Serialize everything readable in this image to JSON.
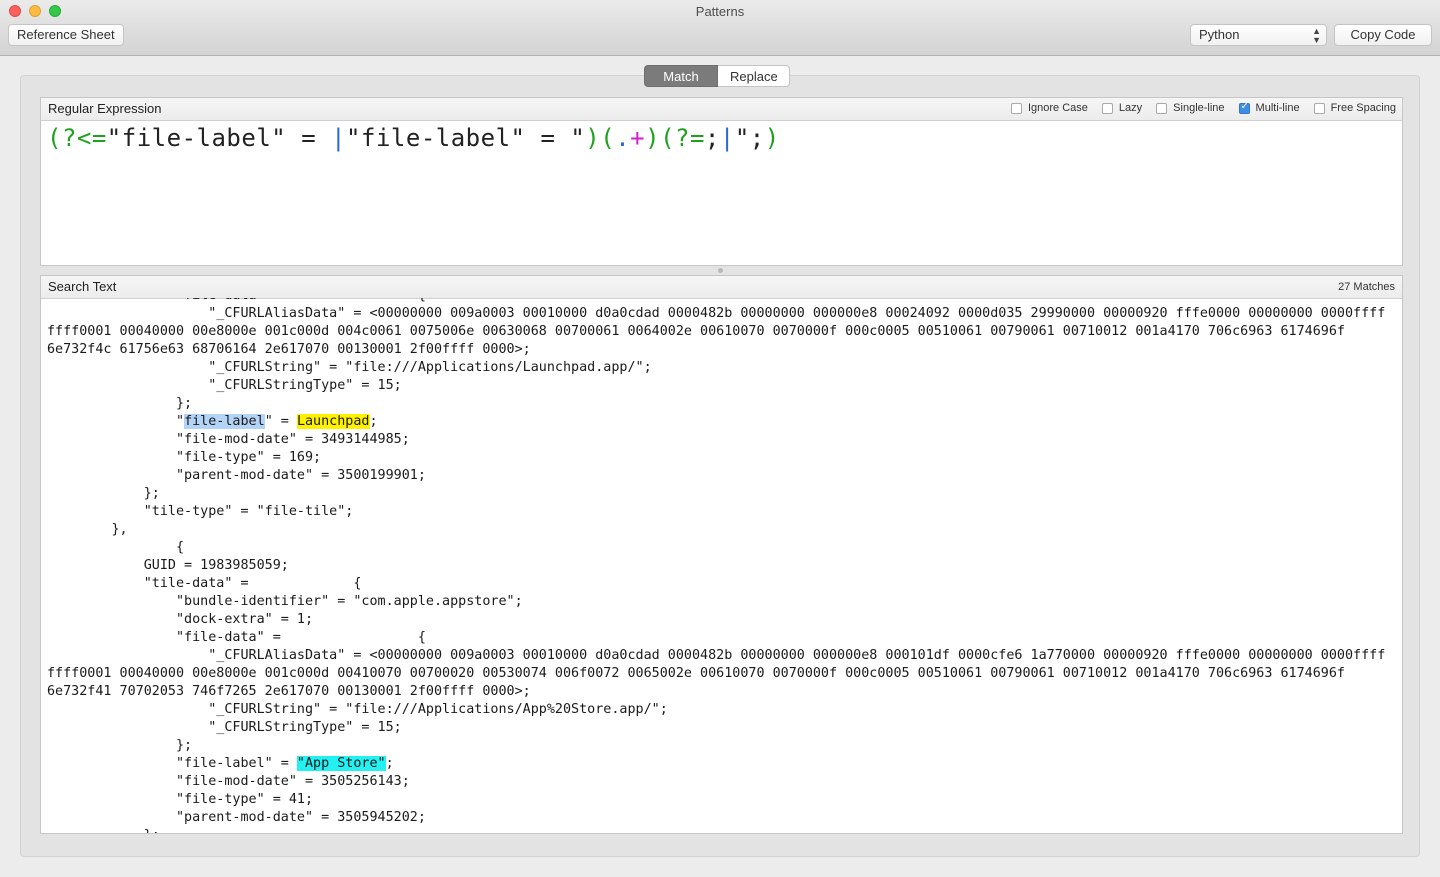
{
  "window": {
    "title": "Patterns"
  },
  "toolbar": {
    "reference_label": "Reference Sheet",
    "language_value": "Python",
    "copy_label": "Copy Code"
  },
  "mode_tabs": {
    "match_label": "Match",
    "replace_label": "Replace"
  },
  "regex_panel": {
    "title": "Regular Expression",
    "expression": "(?<=\"file-label\" = |\"file-label\" = \")(.+)(?=;|\";)",
    "options": {
      "ignore_case": {
        "label": "Ignore Case",
        "checked": false
      },
      "lazy": {
        "label": "Lazy",
        "checked": false
      },
      "single_line": {
        "label": "Single-line",
        "checked": false
      },
      "multi_line": {
        "label": "Multi-line",
        "checked": true
      },
      "free_spacing": {
        "label": "Free Spacing",
        "checked": false
      }
    }
  },
  "search_panel": {
    "title": "Search Text",
    "match_count": "27 Matches",
    "lines": [
      "                \"file-data\" =                 {",
      "                    \"_CFURLAliasData\" = <00000000 009a0003 00010000 d0a0cdad 0000482b 00000000 000000e8 00024092 0000d035 29990000 00000920 fffe0000 00000000 0000ffff",
      "ffff0001 00040000 00e8000e 001c000d 004c0061 0075006e 00630068 00700061 0064002e 00610070 0070000f 000c0005 00510061 00790061 00710012 001a4170 706c6963 6174696f",
      "6e732f4c 61756e63 68706164 2e617070 00130001 2f00ffff 0000>;",
      "                    \"_CFURLString\" = \"file:///Applications/Launchpad.app/\";",
      "                    \"_CFURLStringType\" = 15;",
      "                };",
      "                \"file-label\" = Launchpad;",
      "                \"file-mod-date\" = 3493144985;",
      "                \"file-type\" = 169;",
      "                \"parent-mod-date\" = 3500199901;",
      "            };",
      "            \"tile-type\" = \"file-tile\";",
      "        },",
      "                {",
      "            GUID = 1983985059;",
      "            \"tile-data\" =             {",
      "                \"bundle-identifier\" = \"com.apple.appstore\";",
      "                \"dock-extra\" = 1;",
      "                \"file-data\" =                 {",
      "                    \"_CFURLAliasData\" = <00000000 009a0003 00010000 d0a0cdad 0000482b 00000000 000000e8 000101df 0000cfe6 1a770000 00000920 fffe0000 00000000 0000ffff",
      "ffff0001 00040000 00e8000e 001c000d 00410070 00700020 00530074 006f0072 0065002e 00610070 0070000f 000c0005 00510061 00790061 00710012 001a4170 706c6963 6174696f",
      "6e732f41 70702053 746f7265 2e617070 00130001 2f00ffff 0000>;",
      "                    \"_CFURLString\" = \"file:///Applications/App%20Store.app/\";",
      "                    \"_CFURLStringType\" = 15;",
      "                };",
      "                \"file-label\" = \"App Store\";",
      "                \"file-mod-date\" = 3505256143;",
      "                \"file-type\" = 41;",
      "                \"parent-mod-date\" = 3505945202;",
      "            };"
    ],
    "highlights": {
      "launchpad_key": "file-label",
      "launchpad_value": "Launchpad",
      "appstore_value": "\"App Store\""
    }
  },
  "colors": {
    "regex_group": "#1ea21e",
    "regex_dot": "#2a6ad8",
    "regex_quantifier": "#d21ed2",
    "highlight_key": "#b3d4f6",
    "highlight_match": "#fff200",
    "highlight_match_alt": "#23f0f0",
    "segment_active": "#7b7b7b",
    "checkbox_on": "#3d8ee4"
  }
}
